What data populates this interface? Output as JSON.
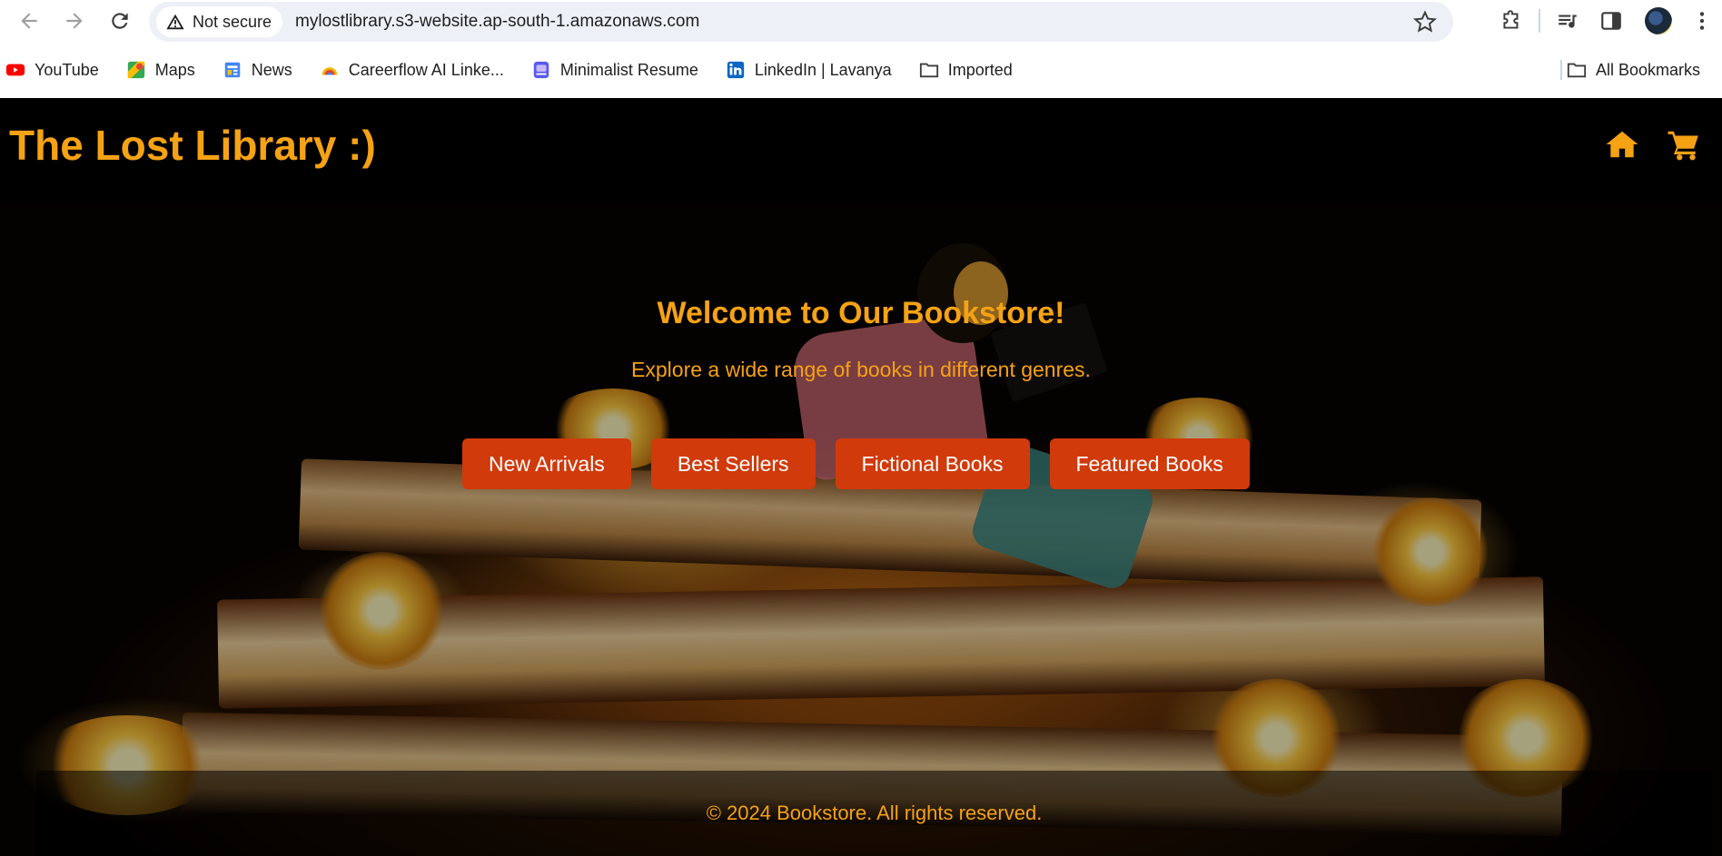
{
  "browser": {
    "security_label": "Not secure",
    "url": "mylostlibrary.s3-website.ap-south-1.amazonaws.com"
  },
  "bookmarks": {
    "items": [
      {
        "label": "YouTube",
        "icon": "youtube-icon"
      },
      {
        "label": "Maps",
        "icon": "maps-icon"
      },
      {
        "label": "News",
        "icon": "news-icon"
      },
      {
        "label": "Careerflow AI Linke...",
        "icon": "careerflow-icon"
      },
      {
        "label": "Minimalist Resume",
        "icon": "resume-icon"
      },
      {
        "label": "LinkedIn | Lavanya",
        "icon": "linkedin-icon"
      },
      {
        "label": "Imported",
        "icon": "folder-icon"
      }
    ],
    "all_label": "All Bookmarks"
  },
  "site": {
    "title": "The Lost Library :)",
    "accent_color": "#f5a214",
    "button_color": "#d13a0b"
  },
  "hero": {
    "title": "Welcome to Our Bookstore!",
    "subtitle": "Explore a wide range of books in different genres.",
    "buttons": [
      "New Arrivals",
      "Best Sellers",
      "Fictional Books",
      "Featured Books"
    ]
  },
  "footer": {
    "text": "© 2024 Bookstore. All rights reserved."
  }
}
